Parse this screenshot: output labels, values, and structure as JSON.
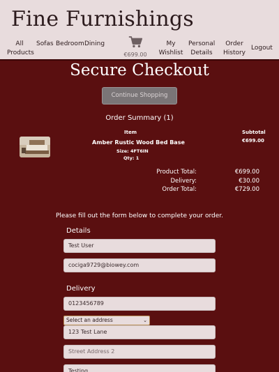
{
  "brand": "Fine Furnishings",
  "nav": {
    "all_products": "All Products",
    "sofas": "Sofas",
    "bedroom": "Bedroom",
    "dining": "Dining",
    "cart_total": "€699.00",
    "my_wishlist": "My Wishlist",
    "personal_details": "Personal Details",
    "order_history": "Order History",
    "logout": "Logout"
  },
  "page_title": "Secure Checkout",
  "continue_label": "Continue Shopping",
  "summary": {
    "title": "Order Summary (1)",
    "col_item": "Item",
    "col_subtotal": "Subtotal",
    "items": [
      {
        "name": "Amber Rustic Wood Bed Base",
        "size": "Size: 4FT6IN",
        "qty": "Qty: 1",
        "subtotal": "€699.00"
      }
    ],
    "product_total_label": "Product Total:",
    "product_total": "€699.00",
    "delivery_label": "Delivery:",
    "delivery": "€30.00",
    "order_total_label": "Order Total:",
    "order_total": "€729.00"
  },
  "form": {
    "instructions": "Please fill out the form below to complete your order.",
    "details_label": "Details",
    "full_name": "Test User",
    "email": "cociga9729@biowey.com",
    "delivery_label": "Delivery",
    "phone": "0123456789",
    "address_select": "Select an address",
    "street1": "123 Test Lane",
    "street2_placeholder": "Street Address 2",
    "town": "Testing"
  },
  "colors": {
    "background": "#5a0f10",
    "header": "#e8dcdd",
    "field": "#e8dcdd",
    "button": "#7a7577"
  },
  "icons": {
    "cart": "shopping-cart-icon",
    "select_arrow": "chevron-down-icon"
  }
}
